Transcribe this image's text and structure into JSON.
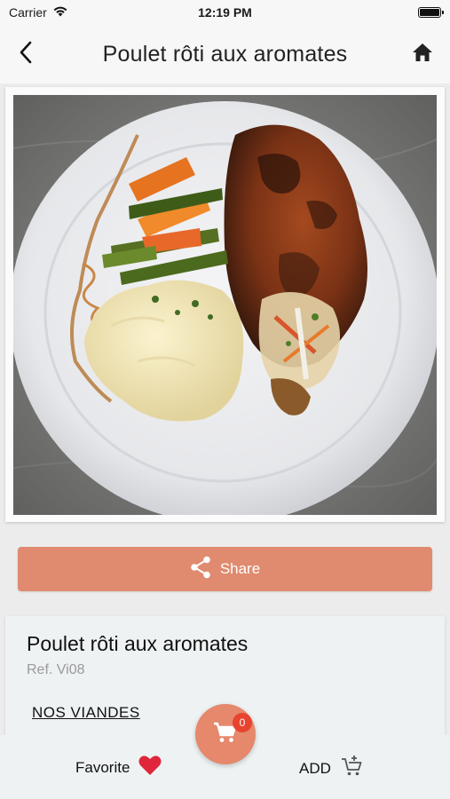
{
  "status_bar": {
    "carrier": "Carrier",
    "time": "12:19 PM"
  },
  "nav": {
    "title": "Poulet rôti aux aromates",
    "back_icon": "chevron-left-icon",
    "home_icon": "home-icon"
  },
  "product": {
    "image_icon": "dish-photo",
    "name": "Poulet rôti aux aromates",
    "ref": "Ref. Vi08",
    "category": "NOS VIANDES"
  },
  "share": {
    "label": "Share",
    "icon": "share-icon"
  },
  "bottom": {
    "favorite_label": "Favorite",
    "favorite_icon": "heart-icon",
    "add_label": "ADD",
    "add_icon": "cart-plus-icon"
  },
  "cart": {
    "count": "0",
    "icon": "cart-icon"
  },
  "colors": {
    "accent": "#e08a6f",
    "badge": "#e8432f",
    "heart": "#e0263a"
  }
}
